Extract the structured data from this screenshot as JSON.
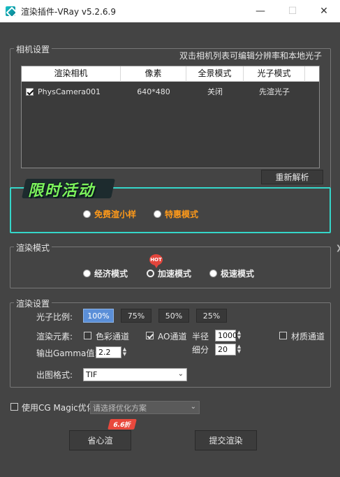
{
  "window": {
    "title": "渲染插件-VRay v5.2.6.9",
    "min_icon": "minimize-icon",
    "max_icon": "maximize-icon",
    "close_icon": "close-icon"
  },
  "camera_settings": {
    "legend": "相机设置",
    "hint": "双击相机列表可编辑分辨率和本地光子",
    "columns": [
      "渲染相机",
      "像素",
      "全景模式",
      "光子模式"
    ],
    "rows": [
      {
        "checked": true,
        "camera": "PhysCamera001",
        "pixels": "640*480",
        "panorama": "关闭",
        "photon": "先渲光子"
      }
    ],
    "reparse_button": "重新解析"
  },
  "promo": {
    "banner": "限时活动",
    "options": [
      {
        "label": "免费渲小样",
        "selected": false
      },
      {
        "label": "特惠模式",
        "selected": false
      }
    ]
  },
  "render_mode": {
    "legend": "渲染模式",
    "hot_badge": "HOT",
    "options": [
      {
        "label": "经济模式",
        "selected": false
      },
      {
        "label": "加速模式",
        "selected": true
      },
      {
        "label": "极速模式",
        "selected": false
      }
    ]
  },
  "render_settings": {
    "legend": "渲染设置",
    "photon_ratio_label": "光子比例:",
    "photon_ratios": [
      "100%",
      "75%",
      "50%",
      "25%"
    ],
    "photon_ratio_selected": "100%",
    "elements_label": "渲染元素:",
    "color_channel": {
      "label": "色彩通道",
      "checked": false
    },
    "ao_channel": {
      "label": "AO通道",
      "checked": true
    },
    "radius_label": "半径",
    "radius_value": "1000",
    "subdiv_label": "细分",
    "subdiv_value": "20",
    "material_channel": {
      "label": "材质通道",
      "checked": false
    },
    "gamma_label": "输出Gamma值:",
    "gamma_value": "2.2",
    "format_label": "出图格式:",
    "format_value": "TIF"
  },
  "cg_magic": {
    "label": "使用CG Magic优化",
    "checked": false,
    "placeholder": "请选择优化方案"
  },
  "footer": {
    "save_button": "省心渲",
    "discount_badge": "6.6折",
    "submit_button": "提交渲染"
  }
}
